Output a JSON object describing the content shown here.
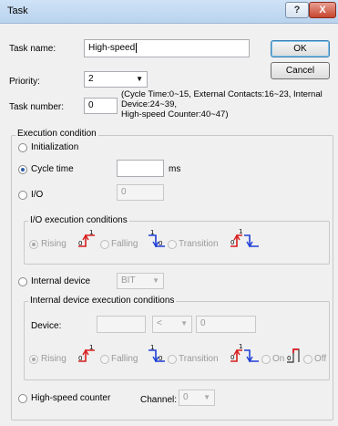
{
  "window": {
    "title": "Task",
    "help_label": "?",
    "close_label": "X"
  },
  "task_name": {
    "label": "Task name:",
    "value": "High-speed"
  },
  "priority": {
    "label": "Priority:",
    "value": "2"
  },
  "task_number": {
    "label": "Task number:",
    "value": "0",
    "hint_line1": "(Cycle Time:0~15, External Contacts:16~23, Internal",
    "hint_line2": "Device:24~39,",
    "hint_line3": "High-speed Counter:40~47)"
  },
  "buttons": {
    "ok": "OK",
    "cancel": "Cancel"
  },
  "execution": {
    "title": "Execution condition",
    "initialization": "Initialization",
    "cycle_time": {
      "label": "Cycle time",
      "value": "",
      "unit": "ms"
    },
    "io": {
      "label": "I/O",
      "value": "0"
    },
    "io_conditions": {
      "title": "I/O execution conditions",
      "rising": "Rising",
      "falling": "Falling",
      "transition": "Transition"
    },
    "internal_device": {
      "label": "Internal device",
      "type": "BIT"
    },
    "internal_conditions": {
      "title": "Internal device execution conditions",
      "device_label": "Device:",
      "device_value": "",
      "operator": "<",
      "compare_value": "0",
      "rising": "Rising",
      "falling": "Falling",
      "transition": "Transition",
      "on": "On",
      "off": "Off"
    },
    "high_speed": {
      "label": "High-speed counter",
      "channel_label": "Channel:",
      "channel_value": "0"
    }
  },
  "selected_execution": "Cycle time",
  "colors": {
    "signal_red": "#d81e1e",
    "signal_blue": "#1f3fd8"
  }
}
